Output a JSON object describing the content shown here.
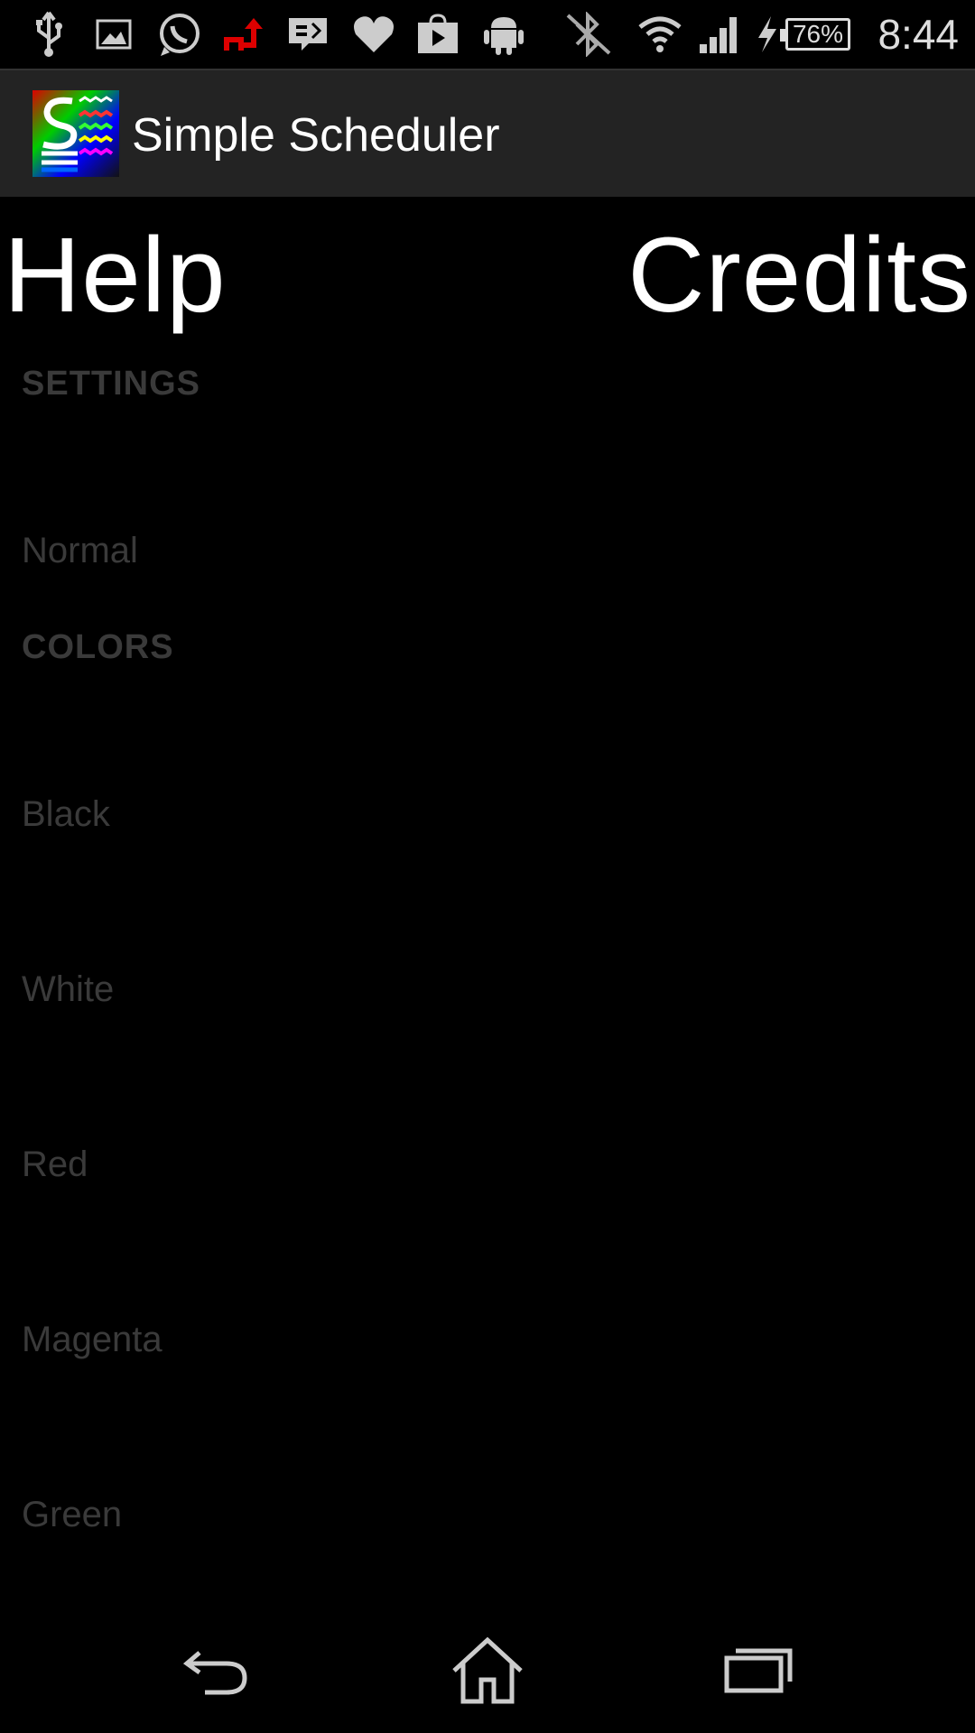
{
  "status_bar": {
    "icons": [
      "usb-icon",
      "image-icon",
      "whatsapp-icon",
      "upload-icon",
      "message-icon",
      "heart-icon",
      "play-store-icon",
      "android-icon",
      "bluetooth-off-icon",
      "wifi-icon",
      "signal-icon",
      "charging-icon"
    ],
    "battery": "76%",
    "time": "8:44"
  },
  "action_bar": {
    "title": "Simple Scheduler",
    "background": "#232323"
  },
  "tabs": {
    "help": "Help",
    "credits": "Credits"
  },
  "settings": {
    "header": "SETTINGS",
    "mode": "Normal"
  },
  "colors": {
    "header": "COLORS",
    "items": [
      "Black",
      "White",
      "Red",
      "Magenta",
      "Green"
    ]
  },
  "text_color": "#3a3a3a"
}
